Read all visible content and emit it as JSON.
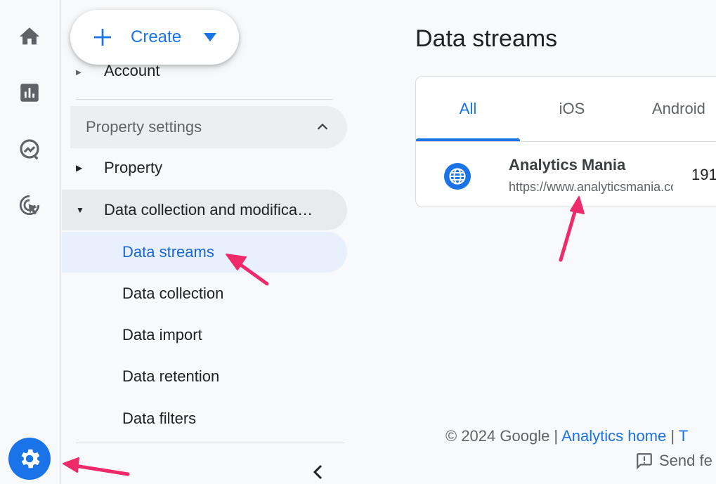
{
  "nav": {
    "create_label": "Create",
    "account_partial": "Account",
    "property_settings": "Property settings",
    "items": [
      {
        "label": "Property"
      },
      {
        "label": "Data collection and modifica…"
      }
    ],
    "sub_items": [
      {
        "label": "Data streams",
        "active": true
      },
      {
        "label": "Data collection"
      },
      {
        "label": "Data import"
      },
      {
        "label": "Data retention"
      },
      {
        "label": "Data filters"
      }
    ]
  },
  "rail_icons": [
    "home-icon",
    "reports-icon",
    "explore-icon",
    "advertising-icon",
    "admin-gear-icon"
  ],
  "main": {
    "title": "Data streams",
    "tabs": [
      {
        "label": "All",
        "active": true
      },
      {
        "label": "iOS"
      },
      {
        "label": "Android"
      }
    ],
    "stream": {
      "name": "Analytics Mania",
      "url": "https://www.analyticsmania.com",
      "id": "191"
    }
  },
  "footer": {
    "copyright": "© 2024 Google |",
    "analytics_home": "Analytics home",
    "sep": "|",
    "terms_partial": "T",
    "send_feedback": "Send fe"
  },
  "colors": {
    "accent": "#1a73e8",
    "active_bg": "#e8f0fe",
    "annotation_arrow": "#ee2a6b"
  }
}
